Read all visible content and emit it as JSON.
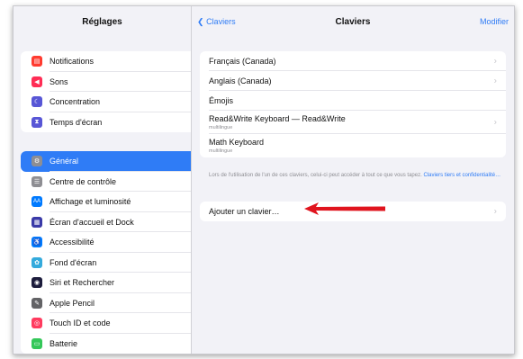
{
  "sidebar": {
    "title": "Réglages",
    "group1": [
      {
        "label": "Notifications",
        "icon": "notifications-icon",
        "color": "#ff3b30",
        "glyph": "▤"
      },
      {
        "label": "Sons",
        "icon": "sound-icon",
        "color": "#ff2d55",
        "glyph": "◀"
      },
      {
        "label": "Concentration",
        "icon": "moon-icon",
        "color": "#5856d6",
        "glyph": "☾"
      },
      {
        "label": "Temps d'écran",
        "icon": "hourglass-icon",
        "color": "#5856d6",
        "glyph": "⧗"
      }
    ],
    "group2": [
      {
        "label": "Général",
        "icon": "gear-icon",
        "color": "#8e8e93",
        "glyph": "⚙",
        "selected": true
      },
      {
        "label": "Centre de contrôle",
        "icon": "control-center-icon",
        "color": "#8e8e93",
        "glyph": "☰"
      },
      {
        "label": "Affichage et luminosité",
        "icon": "display-icon",
        "color": "#007aff",
        "glyph": "AA"
      },
      {
        "label": "Écran d'accueil et Dock",
        "icon": "home-screen-icon",
        "color": "#3a3aa8",
        "glyph": "▦"
      },
      {
        "label": "Accessibilité",
        "icon": "accessibility-icon",
        "color": "#007aff",
        "glyph": "♿"
      },
      {
        "label": "Fond d'écran",
        "icon": "wallpaper-icon",
        "color": "#34aadc",
        "glyph": "✿"
      },
      {
        "label": "Siri et Rechercher",
        "icon": "siri-icon",
        "color": "#1c1c3c",
        "glyph": "◉"
      },
      {
        "label": "Apple Pencil",
        "icon": "pencil-icon",
        "color": "#636366",
        "glyph": "✎"
      },
      {
        "label": "Touch ID et code",
        "icon": "touch-id-icon",
        "color": "#ff3b5f",
        "glyph": "◎"
      },
      {
        "label": "Batterie",
        "icon": "battery-icon",
        "color": "#34c759",
        "glyph": "▭"
      }
    ]
  },
  "nav": {
    "back_label": "Claviers",
    "title": "Claviers",
    "right_label": "Modifier"
  },
  "keyboards": [
    {
      "label": "Français (Canada)",
      "chevron": true
    },
    {
      "label": "Anglais (Canada)",
      "chevron": true
    },
    {
      "label": "Émojis",
      "chevron": false
    },
    {
      "label": "Read&Write Keyboard — Read&Write",
      "sub": "multilingue",
      "chevron": true
    },
    {
      "label": "Math Keyboard",
      "sub": "multilingue",
      "chevron": false
    }
  ],
  "footnote": {
    "text": "Lors de l'utilisation de l'un de ces claviers, celui-ci peut accéder à tout ce que vous tapez. ",
    "link": "Claviers tiers et confidentialité…"
  },
  "add_keyboard": {
    "label": "Ajouter un clavier…"
  },
  "colors": {
    "accent": "#2f7cf6",
    "arrow": "#e0141e"
  }
}
